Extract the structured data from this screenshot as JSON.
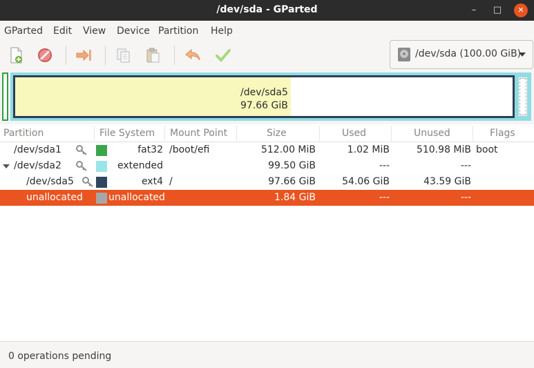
{
  "window": {
    "title": "/dev/sda - GParted",
    "minimize": "–",
    "maximize": "□",
    "close": "✕"
  },
  "menu": [
    "GParted",
    "Edit",
    "View",
    "Device",
    "Partition",
    "Help"
  ],
  "toolbar": {
    "icons": [
      "new-icon",
      "delete-icon",
      "resize-move-icon",
      "copy-icon",
      "paste-icon",
      "undo-icon",
      "apply-icon"
    ],
    "device_selector": "/dev/sda (100.00 GiB)"
  },
  "disk_map": {
    "sda5_label": "/dev/sda5",
    "sda5_size": "97.66 GiB",
    "sda5_used_fraction": 0.554
  },
  "columns": [
    "Partition",
    "File System",
    "Mount Point",
    "Size",
    "Used",
    "Unused",
    "Flags"
  ],
  "rows": [
    {
      "partition": "/dev/sda1",
      "fs": "fat32",
      "mount": "/boot/efi",
      "size": "512.00 MiB",
      "used": "1.02 MiB",
      "unused": "510.98 MiB",
      "flags": "boot",
      "color": "#3aa649"
    },
    {
      "partition": "/dev/sda2",
      "fs": "extended",
      "mount": "",
      "size": "99.50 GiB",
      "used": "---",
      "unused": "---",
      "flags": "",
      "color": "#9ae4ea"
    },
    {
      "partition": "/dev/sda5",
      "fs": "ext4",
      "mount": "/",
      "size": "97.66 GiB",
      "used": "54.06 GiB",
      "unused": "43.59 GiB",
      "flags": "",
      "color": "#2e4660"
    },
    {
      "partition": "unallocated",
      "fs": "unallocated",
      "mount": "",
      "size": "1.84 GiB",
      "used": "---",
      "unused": "---",
      "flags": "",
      "color": "#a7a7a7"
    }
  ],
  "status": "0 operations pending"
}
